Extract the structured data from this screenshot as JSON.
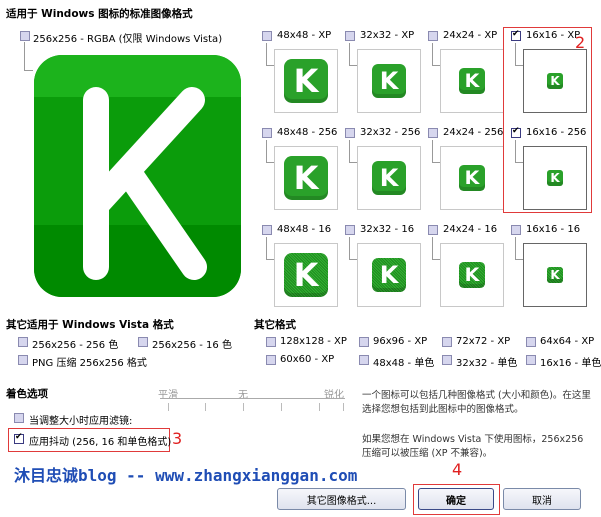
{
  "sections": {
    "windows_formats": "适用于 Windows 图标的标准图像格式",
    "vista_formats": "其它适用于 Windows Vista 格式",
    "other_formats": "其它格式",
    "color_options": "着色选项"
  },
  "main_format": {
    "label": "256x256 - RGBA (仅限 Windows Vista)",
    "checked": false
  },
  "grid_formats": [
    {
      "label": "48x48 - XP",
      "checked": false
    },
    {
      "label": "32x32 - XP",
      "checked": false
    },
    {
      "label": "24x24 - XP",
      "checked": false
    },
    {
      "label": "16x16 - XP",
      "checked": true
    },
    {
      "label": "48x48 - 256",
      "checked": false
    },
    {
      "label": "32x32 - 256",
      "checked": false
    },
    {
      "label": "24x24 - 256",
      "checked": false
    },
    {
      "label": "16x16 - 256",
      "checked": true
    },
    {
      "label": "48x48 - 16",
      "checked": false
    },
    {
      "label": "32x32 - 16",
      "checked": false
    },
    {
      "label": "24x24 - 16",
      "checked": false
    },
    {
      "label": "16x16 - 16",
      "checked": false
    }
  ],
  "icon_letter": "K",
  "vista_options": [
    {
      "label": "256x256 - 256 色",
      "checked": false
    },
    {
      "label": "256x256 - 16 色",
      "checked": false
    },
    {
      "label": "PNG 压缩 256x256 格式",
      "checked": false
    }
  ],
  "other_options": [
    {
      "label": "128x128 - XP",
      "checked": false
    },
    {
      "label": "96x96 - XP",
      "checked": false
    },
    {
      "label": "72x72 - XP",
      "checked": false
    },
    {
      "label": "64x64 - XP",
      "checked": false
    },
    {
      "label": "60x60 - XP",
      "checked": false
    },
    {
      "label": "48x48 - 单色",
      "checked": false
    },
    {
      "label": "32x32 - 单色",
      "checked": false
    },
    {
      "label": "16x16 - 单色",
      "checked": false
    }
  ],
  "slider_labels": [
    "平滑",
    "无",
    "锐化"
  ],
  "color_checks": [
    {
      "label": "当调整大小时应用滤镜:",
      "checked": false
    },
    {
      "label": "应用抖动 (256, 16 和单色格式)",
      "checked": true
    }
  ],
  "description_1": "一个图标可以包括几种图像格式 (大小和颜色)。在这里选择您想包括到此图标中的图像格式。",
  "description_2": "如果您想在 Windows Vista 下使用图标，256x256 压缩可以被压缩 (XP 不兼容)。",
  "watermark": "沐目忠诚blog -- www.zhangxianggan.com",
  "buttons": {
    "more": "其它图像格式...",
    "ok": "确定",
    "cancel": "取消"
  },
  "annotations": [
    "2",
    "3",
    "4"
  ],
  "colors": {
    "icon_green": "#2aa12a",
    "highlight_red": "#e03a3a",
    "watermark_blue": "#1f4db5"
  }
}
